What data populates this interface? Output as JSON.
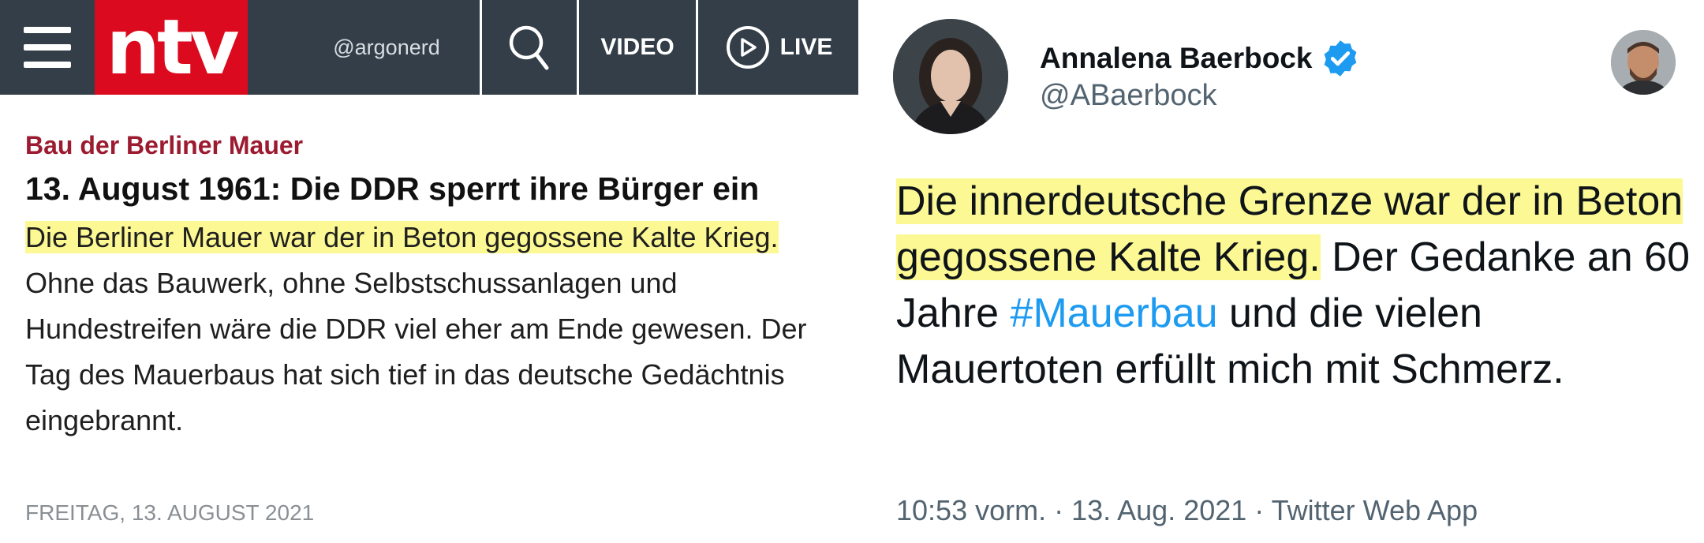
{
  "ntv": {
    "header": {
      "logo_text": "ntv",
      "user_handle": "@argonerd",
      "video_label": "VIDEO",
      "live_label": "LIVE"
    },
    "article": {
      "kicker": "Bau der Berliner Mauer",
      "headline": "13. August 1961: Die DDR sperrt ihre Bürger ein",
      "lead_highlighted": "Die Berliner Mauer war der in Beton gegossene Kalte Krieg.",
      "lead_rest": " Ohne das Bauwerk, ohne Selbstschussanlagen und Hundestreifen wäre die DDR viel eher am Ende gewesen. Der Tag des Mauerbaus hat sich tief in das deutsche Gedächtnis eingebrannt.",
      "dateline": "FREITAG, 13. AUGUST 2021"
    },
    "colors": {
      "header_bg": "#333e48",
      "logo_bg": "#dc0a1e",
      "kicker": "#9c1b30",
      "highlight": "#fcf994"
    }
  },
  "tweet": {
    "author_name": "Annalena Baerbock",
    "author_handle": "@ABaerbock",
    "verified": true,
    "text_highlighted": "Die innerdeutsche Grenze war der in Beton gegossene Kalte Krieg.",
    "text_part2": " Der Gedanke an 60 Jahre ",
    "hashtag": "#Mauerbau",
    "text_part3": " und die vielen Mauertoten erfüllt mich mit Schmerz.",
    "meta": "10:53 vorm. · 13. Aug. 2021 · Twitter Web App",
    "colors": {
      "hashtag": "#1d9bf0",
      "verified": "#1d9bf0",
      "meta": "#536471"
    }
  }
}
